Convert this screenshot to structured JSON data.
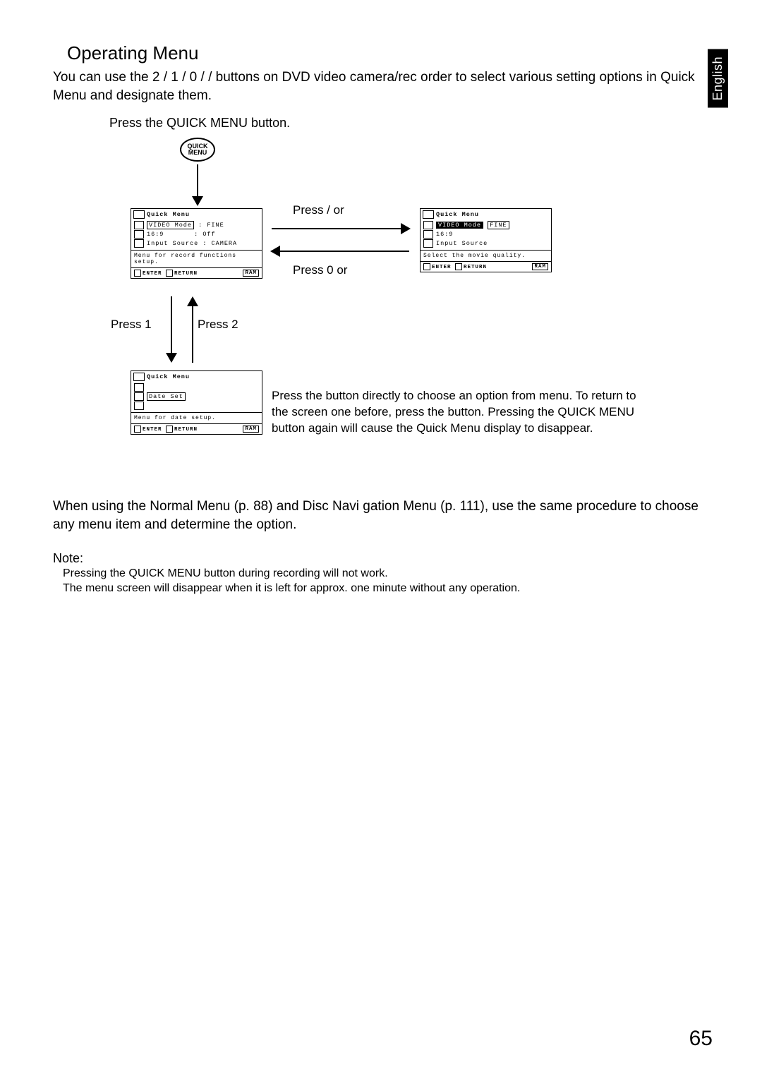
{
  "lang_tab": "English",
  "title": "Operating Menu",
  "intro": "You can use the 2  / 1  / 0 /  /    buttons on DVD video camera/rec order to select various setting options in Quick Menu and designate them.",
  "instruction": "Press the QUICK MENU button.",
  "quick_btn_line1": "QUICK",
  "quick_btn_line2": "MENU",
  "label_press_right": "Press  /   or",
  "label_press_left": "Press  0   or",
  "label_press_down": "Press  1",
  "label_press_up": "Press  2",
  "screen1": {
    "title": "Quick Menu",
    "r1a": "VIDEO Mode",
    "r1b": ": FINE",
    "r2a": "16:9",
    "r2b": ": Off",
    "r3a": "Input Source",
    "r3b": ": CAMERA",
    "msg": "Menu for record functions setup.",
    "foot_l": "ENTER",
    "foot_m": "RETURN",
    "foot_r": "RAM"
  },
  "screen2": {
    "title": "Quick Menu",
    "r1a": "VIDEO Mode",
    "r1b": "FINE",
    "r2a": "16:9",
    "r3a": "Input Source",
    "msg": "Select the movie quality.",
    "foot_l": "ENTER",
    "foot_m": "RETURN",
    "foot_r": "RAM"
  },
  "screen3": {
    "title": "Quick Menu",
    "r1a": "Date Set",
    "msg": "Menu for date setup.",
    "foot_l": "ENTER",
    "foot_m": "RETURN",
    "foot_r": "RAM"
  },
  "explain": "Press the      button directly to choose an option from menu. To return to the screen one before, press the     button. Pressing the QUICK MENU button again will cause the Quick Menu display to disappear.",
  "closing": "When using the Normal Menu (p. 88) and Disc Navi gation Menu (p. 111), use the same procedure to choose any menu item and determine the option.",
  "note_head": "Note:",
  "note_body": "Pressing the QUICK MENU button during recording will not work.\nThe menu screen will disappear when it is left for approx. one minute without any operation.",
  "page_number": "65"
}
